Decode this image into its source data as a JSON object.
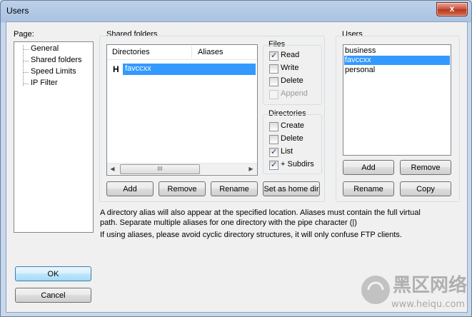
{
  "window": {
    "title": "Users",
    "close_glyph": "x"
  },
  "page_nav": {
    "label": "Page:",
    "items": [
      {
        "label": "General",
        "selected": false
      },
      {
        "label": "Shared folders",
        "selected": true
      },
      {
        "label": "Speed Limits",
        "selected": false
      },
      {
        "label": "IP Filter",
        "selected": false
      }
    ]
  },
  "shared_folders": {
    "group_label": "Shared folders",
    "columns": [
      "Directories",
      "Aliases"
    ],
    "rows": [
      {
        "marker": "H",
        "directory": "favccxx",
        "alias": "",
        "selected": true
      }
    ],
    "scroll_thumb_glyph": "III",
    "buttons": {
      "add": "Add",
      "remove": "Remove",
      "rename": "Rename",
      "set_home": "Set as home dir"
    }
  },
  "files": {
    "label": "Files",
    "options": [
      {
        "label": "Read",
        "checked": true,
        "disabled": false
      },
      {
        "label": "Write",
        "checked": false,
        "disabled": false
      },
      {
        "label": "Delete",
        "checked": false,
        "disabled": false
      },
      {
        "label": "Append",
        "checked": false,
        "disabled": true
      }
    ]
  },
  "directories": {
    "label": "Directories",
    "options": [
      {
        "label": "Create",
        "checked": false
      },
      {
        "label": "Delete",
        "checked": false
      },
      {
        "label": "List",
        "checked": true
      },
      {
        "label": "+ Subdirs",
        "checked": true
      }
    ]
  },
  "users": {
    "label": "Users",
    "list": [
      {
        "name": "business",
        "selected": false
      },
      {
        "name": "favccxx",
        "selected": true
      },
      {
        "name": "personal",
        "selected": false
      }
    ],
    "buttons": {
      "add": "Add",
      "remove": "Remove",
      "rename": "Rename",
      "copy": "Copy"
    }
  },
  "info": {
    "line1": "A directory alias will also appear at the specified location. Aliases must contain the full virtual",
    "line2": "path. Separate multiple aliases for one directory with the pipe character (|)",
    "line3": "If using aliases, please avoid cyclic directory structures, it will only confuse FTP clients."
  },
  "dialog_buttons": {
    "ok": "OK",
    "cancel": "Cancel"
  },
  "watermark": {
    "text_cn": "黑区网络",
    "url": "www.heiqu.com"
  },
  "colors": {
    "selection": "#3399ff",
    "title_bar": "#bcd1ea",
    "close_button": "#c7503b"
  }
}
